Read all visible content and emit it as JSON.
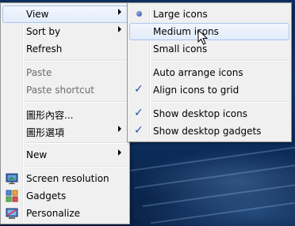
{
  "main_menu": {
    "items": [
      {
        "label": "View"
      },
      {
        "label": "Sort by"
      },
      {
        "label": "Refresh"
      },
      {
        "label": "Paste"
      },
      {
        "label": "Paste shortcut"
      },
      {
        "label": "圖形內容..."
      },
      {
        "label": "圖形選項"
      },
      {
        "label": "New"
      },
      {
        "label": "Screen resolution"
      },
      {
        "label": "Gadgets"
      },
      {
        "label": "Personalize"
      }
    ]
  },
  "view_submenu": {
    "items": [
      {
        "label": "Large icons",
        "selected": true
      },
      {
        "label": "Medium icons"
      },
      {
        "label": "Small icons"
      },
      {
        "label": "Auto arrange icons",
        "checked": false
      },
      {
        "label": "Align icons to grid",
        "checked": true
      },
      {
        "label": "Show desktop icons",
        "checked": true
      },
      {
        "label": "Show desktop gadgets",
        "checked": true
      }
    ]
  },
  "colors": {
    "menu_bg": "#f0f0f0",
    "hover_border": "#a9c6ee",
    "check": "#1e4fa3",
    "desktop": "#143e75"
  }
}
